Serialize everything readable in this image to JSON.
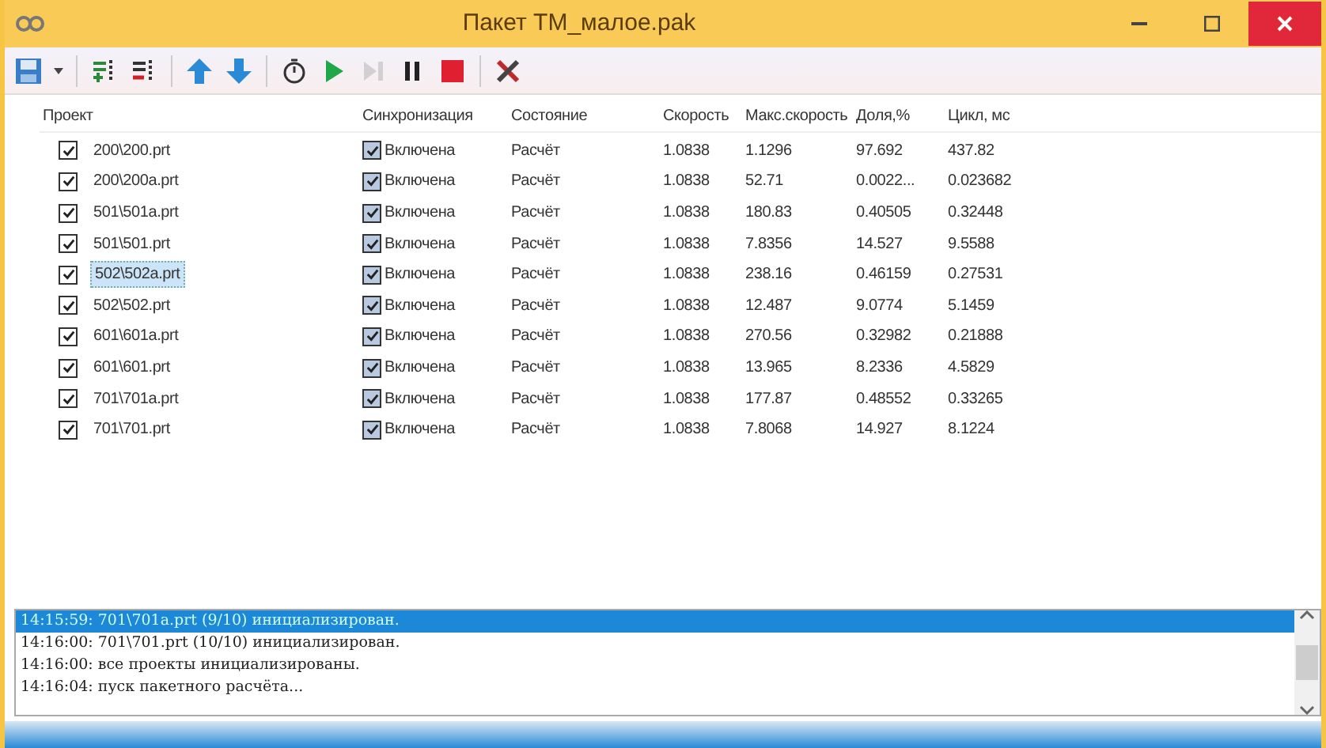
{
  "window": {
    "title": "Пакет  ТМ_малое.pak"
  },
  "toolbar": {
    "buttons": [
      {
        "kind": "save"
      },
      {
        "kind": "caret"
      },
      {
        "kind": "sep"
      },
      {
        "kind": "add"
      },
      {
        "kind": "remove"
      },
      {
        "kind": "sep"
      },
      {
        "kind": "up"
      },
      {
        "kind": "down"
      },
      {
        "kind": "sep"
      },
      {
        "kind": "timer"
      },
      {
        "kind": "play"
      },
      {
        "kind": "step",
        "disabled": true
      },
      {
        "kind": "pause"
      },
      {
        "kind": "stop"
      },
      {
        "kind": "sep"
      },
      {
        "kind": "tools"
      }
    ]
  },
  "table": {
    "columns": [
      "Проект",
      "Синхронизация",
      "Состояние",
      "Скорость",
      "Макс.скорость",
      "Доля,%",
      "Цикл, мс"
    ],
    "rows": [
      {
        "checked": true,
        "project": "200\\200.prt",
        "sync_checked": true,
        "sync": "Включена",
        "state": "Расчёт",
        "speed": "1.0838",
        "max_speed": "1.1296",
        "share": "97.692",
        "cycle": "437.82",
        "selected": false
      },
      {
        "checked": true,
        "project": "200\\200a.prt",
        "sync_checked": true,
        "sync": "Включена",
        "state": "Расчёт",
        "speed": "1.0838",
        "max_speed": "52.71",
        "share": "0.0022...",
        "cycle": "0.023682",
        "selected": false
      },
      {
        "checked": true,
        "project": "501\\501a.prt",
        "sync_checked": true,
        "sync": "Включена",
        "state": "Расчёт",
        "speed": "1.0838",
        "max_speed": "180.83",
        "share": "0.40505",
        "cycle": "0.32448",
        "selected": false
      },
      {
        "checked": true,
        "project": "501\\501.prt",
        "sync_checked": true,
        "sync": "Включена",
        "state": "Расчёт",
        "speed": "1.0838",
        "max_speed": "7.8356",
        "share": "14.527",
        "cycle": "9.5588",
        "selected": false
      },
      {
        "checked": true,
        "project": "502\\502a.prt",
        "sync_checked": true,
        "sync": "Включена",
        "state": "Расчёт",
        "speed": "1.0838",
        "max_speed": "238.16",
        "share": "0.46159",
        "cycle": "0.27531",
        "selected": true
      },
      {
        "checked": true,
        "project": "502\\502.prt",
        "sync_checked": true,
        "sync": "Включена",
        "state": "Расчёт",
        "speed": "1.0838",
        "max_speed": "12.487",
        "share": "9.0774",
        "cycle": "5.1459",
        "selected": false
      },
      {
        "checked": true,
        "project": "601\\601a.prt",
        "sync_checked": true,
        "sync": "Включена",
        "state": "Расчёт",
        "speed": "1.0838",
        "max_speed": "270.56",
        "share": "0.32982",
        "cycle": "0.21888",
        "selected": false
      },
      {
        "checked": true,
        "project": "601\\601.prt",
        "sync_checked": true,
        "sync": "Включена",
        "state": "Расчёт",
        "speed": "1.0838",
        "max_speed": "13.965",
        "share": "8.2336",
        "cycle": "4.5829",
        "selected": false
      },
      {
        "checked": true,
        "project": "701\\701a.prt",
        "sync_checked": true,
        "sync": "Включена",
        "state": "Расчёт",
        "speed": "1.0838",
        "max_speed": "177.87",
        "share": "0.48552",
        "cycle": "0.33265",
        "selected": false
      },
      {
        "checked": true,
        "project": "701\\701.prt",
        "sync_checked": true,
        "sync": "Включена",
        "state": "Расчёт",
        "speed": "1.0838",
        "max_speed": "7.8068",
        "share": "14.927",
        "cycle": "8.1224",
        "selected": false
      }
    ]
  },
  "log": [
    {
      "text": "14:15:59: 701\\701a.prt (9/10) инициализирован.",
      "selected": true
    },
    {
      "text": "14:16:00: 701\\701.prt (10/10) инициализирован.",
      "selected": false
    },
    {
      "text": "14:16:00:  все проекты инициализированы.",
      "selected": false
    },
    {
      "text": "14:16:04:  пуск пакетного расчёта...",
      "selected": false
    }
  ]
}
